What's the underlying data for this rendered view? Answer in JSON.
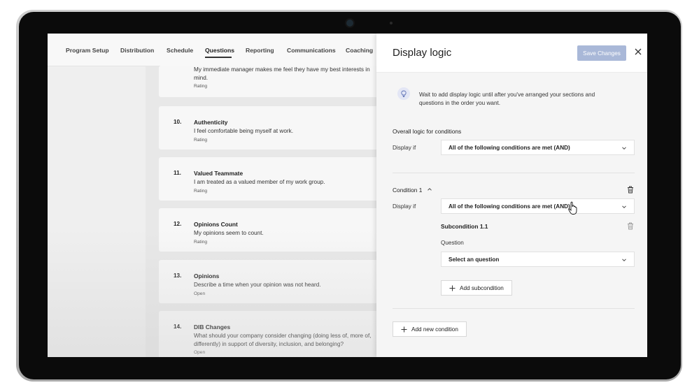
{
  "nav": {
    "tabs": [
      {
        "label": "Program Setup"
      },
      {
        "label": "Distribution"
      },
      {
        "label": "Schedule"
      },
      {
        "label": "Questions"
      },
      {
        "label": "Reporting"
      },
      {
        "label": "Communications"
      },
      {
        "label": "Coaching"
      }
    ],
    "active_tab": "Questions"
  },
  "questions": [
    {
      "number": "",
      "title": "",
      "text": "My immediate manager makes me feel they have my best interests in mind.",
      "type": "Rating"
    },
    {
      "number": "10.",
      "title": "Authenticity",
      "text": "I feel comfortable being myself at work.",
      "type": "Rating"
    },
    {
      "number": "11.",
      "title": "Valued Teammate",
      "text": "I am treated as a valued member of my work group.",
      "type": "Rating"
    },
    {
      "number": "12.",
      "title": "Opinions Count",
      "text": "My opinions seem to count.",
      "type": "Rating"
    },
    {
      "number": "13.",
      "title": "Opinions",
      "text": "Describe a time when your opinion was not heard.",
      "type": "Open"
    },
    {
      "number": "14.",
      "title": "DIB Changes",
      "text": "What should your company consider changing (doing less of, more of, differently) in support of diversity, inclusion, and belonging?",
      "type": "Open"
    }
  ],
  "panel": {
    "title": "Display logic",
    "save_label": "Save Changes",
    "info_text": "Wait to add display logic until after you've arranged your sections and questions in the order you want.",
    "overall_label": "Overall logic for conditions",
    "display_if_label": "Display if",
    "overall_value": "All of the following conditions are met (AND)",
    "condition_label": "Condition 1",
    "condition_value": "All of the following conditions are met (AND)",
    "subcondition_label": "Subcondition 1.1",
    "question_label": "Question",
    "question_placeholder": "Select an question",
    "add_subcondition_label": "Add subcondition",
    "add_condition_label": "Add new condition"
  },
  "colors": {
    "save_button_disabled": "#a9b8d8",
    "panel_background": "#f5f5f5",
    "info_icon_background": "#e3e6f5"
  }
}
